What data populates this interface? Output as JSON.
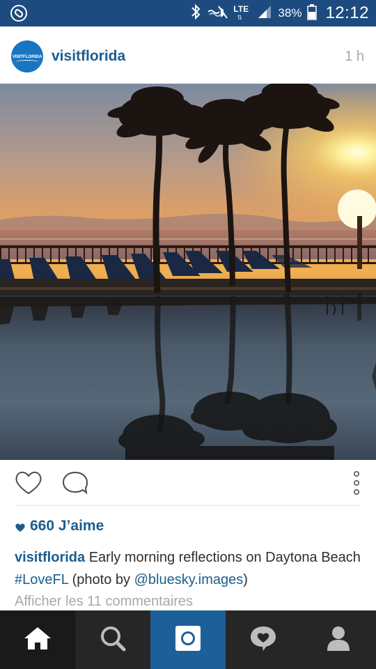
{
  "status_bar": {
    "lte_label": "LTE",
    "battery_percent": "38%",
    "time": "12:12"
  },
  "post": {
    "username": "visitflorida",
    "avatar_text": "VISITFLORIDA",
    "time_ago": "1 h",
    "likes": "660 J’aime",
    "caption": {
      "username": "visitflorida",
      "text_1": " Early morning reflections on Daytona Beach ",
      "hashtag": "#LoveFL",
      "text_2": " (photo by ",
      "mention": "@bluesky.images",
      "text_3": ")"
    },
    "view_comments": "Afficher les 11 commentaires"
  },
  "actions": {
    "like_icon": "heart-outline-icon",
    "comment_icon": "speech-bubble-icon",
    "more_icon": "vertical-dots-icon"
  },
  "bottom_nav": {
    "items": [
      "home-icon",
      "search-icon",
      "camera-icon",
      "activity-heart-icon",
      "profile-icon"
    ],
    "active": "home-icon"
  },
  "colors": {
    "status_bar": "#1d4b80",
    "brand_blue": "#1c5d8e",
    "nav_bg": "#262626",
    "nav_camera": "#1d5f98",
    "muted_text": "#a8a8a8"
  }
}
